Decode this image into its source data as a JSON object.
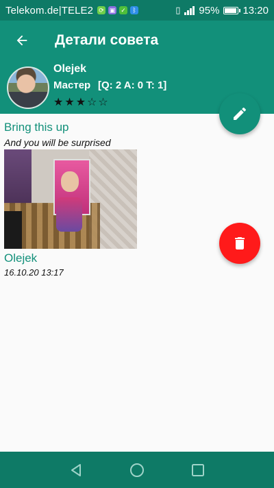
{
  "status_bar": {
    "carrier": "Telekom.de|TELE2",
    "battery_percent": "95%",
    "time": "13:20",
    "battery_level": 0.95,
    "notification_icons": [
      "sync-icon",
      "gallery-icon",
      "notification-icon",
      "bluetooth-icon"
    ]
  },
  "app_bar": {
    "title": "Детали совета",
    "back_icon": "arrow-left-icon"
  },
  "profile": {
    "name": "Olejek",
    "rank": "Мастер",
    "stats": "[Q: 2 A: 0 T: 1]",
    "stars_filled": 3,
    "stars_total": 5
  },
  "tip": {
    "title": "Bring this up",
    "body": "And you will be surprised",
    "author": "Olejek",
    "date": "16.10.20 13:17"
  },
  "actions": {
    "edit_icon": "pencil-icon",
    "delete_icon": "trash-icon"
  },
  "colors": {
    "primary": "#12907a",
    "primary_dark": "#0e7a66",
    "delete": "#ff1a1a",
    "background": "#fafafa"
  },
  "nav_bar": {
    "icons": [
      "back-triangle-icon",
      "home-circle-icon",
      "recents-square-icon"
    ]
  }
}
